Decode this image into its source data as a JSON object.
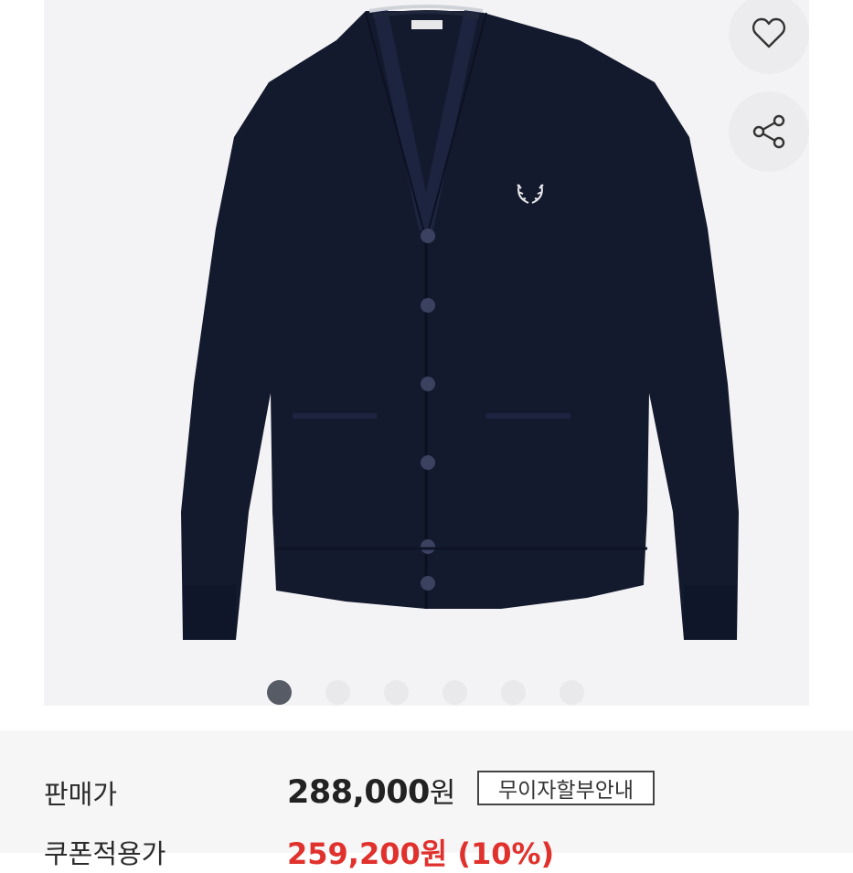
{
  "product": {
    "image_alt": "Navy knit V-neck cardigan",
    "brand_tag_text": "FRED PERRY"
  },
  "actions": {
    "like_icon": "heart-icon",
    "share_icon": "share-icon"
  },
  "carousel": {
    "total": 6,
    "active_index": 0
  },
  "pricing": {
    "sale_label": "판매가",
    "sale_price": "288,000",
    "currency": "원",
    "installment_button": "무이자할부안내",
    "coupon_label": "쿠폰적용가",
    "coupon_price": "259,200원 (10%)"
  },
  "colors": {
    "garment": "#141a2e",
    "coupon_red": "#e0312d",
    "active_dot": "#575b66"
  }
}
